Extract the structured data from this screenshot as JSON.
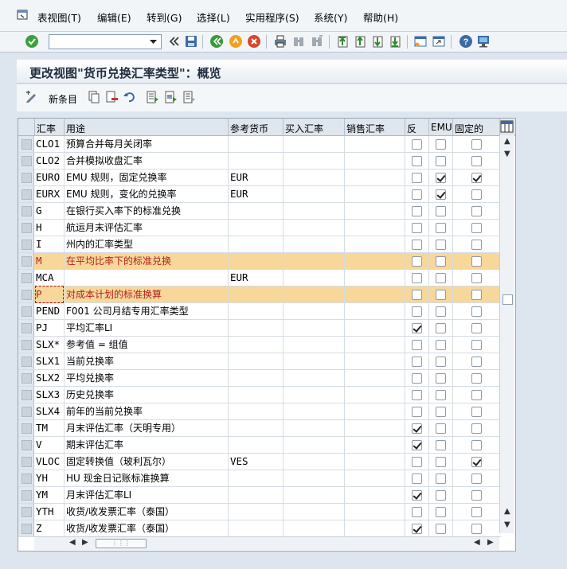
{
  "menu": {
    "items": [
      "表视图(T)",
      "编辑(E)",
      "转到(G)",
      "选择(L)",
      "实用程序(S)",
      "系统(Y)",
      "帮助(H)"
    ]
  },
  "toolbar": {
    "command_field_value": "",
    "icons": [
      "enter-icon",
      "back-history-icon",
      "save-icon",
      "back-icon",
      "exit-icon",
      "cancel-icon",
      "print-icon",
      "find-icon",
      "find-next-icon",
      "first-page-icon",
      "previous-page-icon",
      "next-page-icon",
      "last-page-icon",
      "create-session-icon",
      "shortcut-icon",
      "help-icon",
      "layout-icon"
    ]
  },
  "title": "更改视图\"货币兑换汇率类型\"：概览",
  "app_toolbar": {
    "new_entries_label": "新条目",
    "icons": [
      "display-change-icon",
      "copy-icon",
      "delete-icon",
      "undo-icon",
      "select-all-icon",
      "select-block-icon",
      "deselect-all-icon"
    ]
  },
  "table": {
    "columns": [
      "汇率",
      "用途",
      "参考货币",
      "买入汇率",
      "销售汇率",
      "反",
      "EMU",
      "固定的"
    ],
    "rows": [
      {
        "code": "CLO1",
        "usage": "预算合并每月关闭率",
        "ref": "",
        "buy": "",
        "sell": "",
        "inv": false,
        "emu": false,
        "fixed": false,
        "highlight": false
      },
      {
        "code": "CLO2",
        "usage": "合并模拟收盘汇率",
        "ref": "",
        "buy": "",
        "sell": "",
        "inv": false,
        "emu": false,
        "fixed": false,
        "highlight": false
      },
      {
        "code": "EURO",
        "usage": "EMU 规则，固定兑换率",
        "ref": "EUR",
        "buy": "",
        "sell": "",
        "inv": false,
        "emu": true,
        "fixed": true,
        "highlight": false
      },
      {
        "code": "EURX",
        "usage": "EMU 规则，变化的兑换率",
        "ref": "EUR",
        "buy": "",
        "sell": "",
        "inv": false,
        "emu": true,
        "fixed": false,
        "highlight": false
      },
      {
        "code": "G",
        "usage": "在银行买入率下的标准兑换",
        "ref": "",
        "buy": "",
        "sell": "",
        "inv": false,
        "emu": false,
        "fixed": false,
        "highlight": false
      },
      {
        "code": "H",
        "usage": "航运月末评估汇率",
        "ref": "",
        "buy": "",
        "sell": "",
        "inv": false,
        "emu": false,
        "fixed": false,
        "highlight": false
      },
      {
        "code": "I",
        "usage": "州内的汇率类型",
        "ref": "",
        "buy": "",
        "sell": "",
        "inv": false,
        "emu": false,
        "fixed": false,
        "highlight": false
      },
      {
        "code": "M",
        "usage": "在平均比率下的标准兑换",
        "ref": "",
        "buy": "",
        "sell": "",
        "inv": false,
        "emu": false,
        "fixed": false,
        "highlight": true
      },
      {
        "code": "MCA",
        "usage": "",
        "ref": "EUR",
        "buy": "",
        "sell": "",
        "inv": false,
        "emu": false,
        "fixed": false,
        "highlight": false
      },
      {
        "code": "P",
        "usage": "对成本计划的标准换算",
        "ref": "",
        "buy": "",
        "sell": "",
        "inv": false,
        "emu": false,
        "fixed": false,
        "highlight": true
      },
      {
        "code": "PEND",
        "usage": "F001 公司月结专用汇率类型",
        "ref": "",
        "buy": "",
        "sell": "",
        "inv": false,
        "emu": false,
        "fixed": false,
        "highlight": false
      },
      {
        "code": "PJ",
        "usage": "平均汇率LI",
        "ref": "",
        "buy": "",
        "sell": "",
        "inv": true,
        "emu": false,
        "fixed": false,
        "highlight": false
      },
      {
        "code": "SLX*",
        "usage": "参考值 = 组值",
        "ref": "",
        "buy": "",
        "sell": "",
        "inv": false,
        "emu": false,
        "fixed": false,
        "highlight": false
      },
      {
        "code": "SLX1",
        "usage": "当前兑换率",
        "ref": "",
        "buy": "",
        "sell": "",
        "inv": false,
        "emu": false,
        "fixed": false,
        "highlight": false
      },
      {
        "code": "SLX2",
        "usage": "平均兑换率",
        "ref": "",
        "buy": "",
        "sell": "",
        "inv": false,
        "emu": false,
        "fixed": false,
        "highlight": false
      },
      {
        "code": "SLX3",
        "usage": "历史兑换率",
        "ref": "",
        "buy": "",
        "sell": "",
        "inv": false,
        "emu": false,
        "fixed": false,
        "highlight": false
      },
      {
        "code": "SLX4",
        "usage": "前年的当前兑换率",
        "ref": "",
        "buy": "",
        "sell": "",
        "inv": false,
        "emu": false,
        "fixed": false,
        "highlight": false
      },
      {
        "code": "TM",
        "usage": "月末评估汇率（天明专用）",
        "ref": "",
        "buy": "",
        "sell": "",
        "inv": true,
        "emu": false,
        "fixed": false,
        "highlight": false
      },
      {
        "code": "V",
        "usage": "期末评估汇率",
        "ref": "",
        "buy": "",
        "sell": "",
        "inv": true,
        "emu": false,
        "fixed": false,
        "highlight": false
      },
      {
        "code": "VLOC",
        "usage": "固定转换值（玻利瓦尔）",
        "ref": "VES",
        "buy": "",
        "sell": "",
        "inv": false,
        "emu": false,
        "fixed": true,
        "highlight": false
      },
      {
        "code": "YH",
        "usage": "HU 现金日记账标准换算",
        "ref": "",
        "buy": "",
        "sell": "",
        "inv": false,
        "emu": false,
        "fixed": false,
        "highlight": false
      },
      {
        "code": "YM",
        "usage": "月末评估汇率LI",
        "ref": "",
        "buy": "",
        "sell": "",
        "inv": true,
        "emu": false,
        "fixed": false,
        "highlight": false
      },
      {
        "code": "YTH",
        "usage": "收货/收发票汇率（泰国）",
        "ref": "",
        "buy": "",
        "sell": "",
        "inv": false,
        "emu": false,
        "fixed": false,
        "highlight": false
      },
      {
        "code": "Z",
        "usage": "收货/收发票汇率（泰国）",
        "ref": "",
        "buy": "",
        "sell": "",
        "inv": true,
        "emu": false,
        "fixed": false,
        "highlight": false
      }
    ]
  },
  "colors": {
    "highlight_row": "#f8d79b",
    "highlight_text": "#b3221a",
    "header_bg": "#dfe6ee"
  }
}
